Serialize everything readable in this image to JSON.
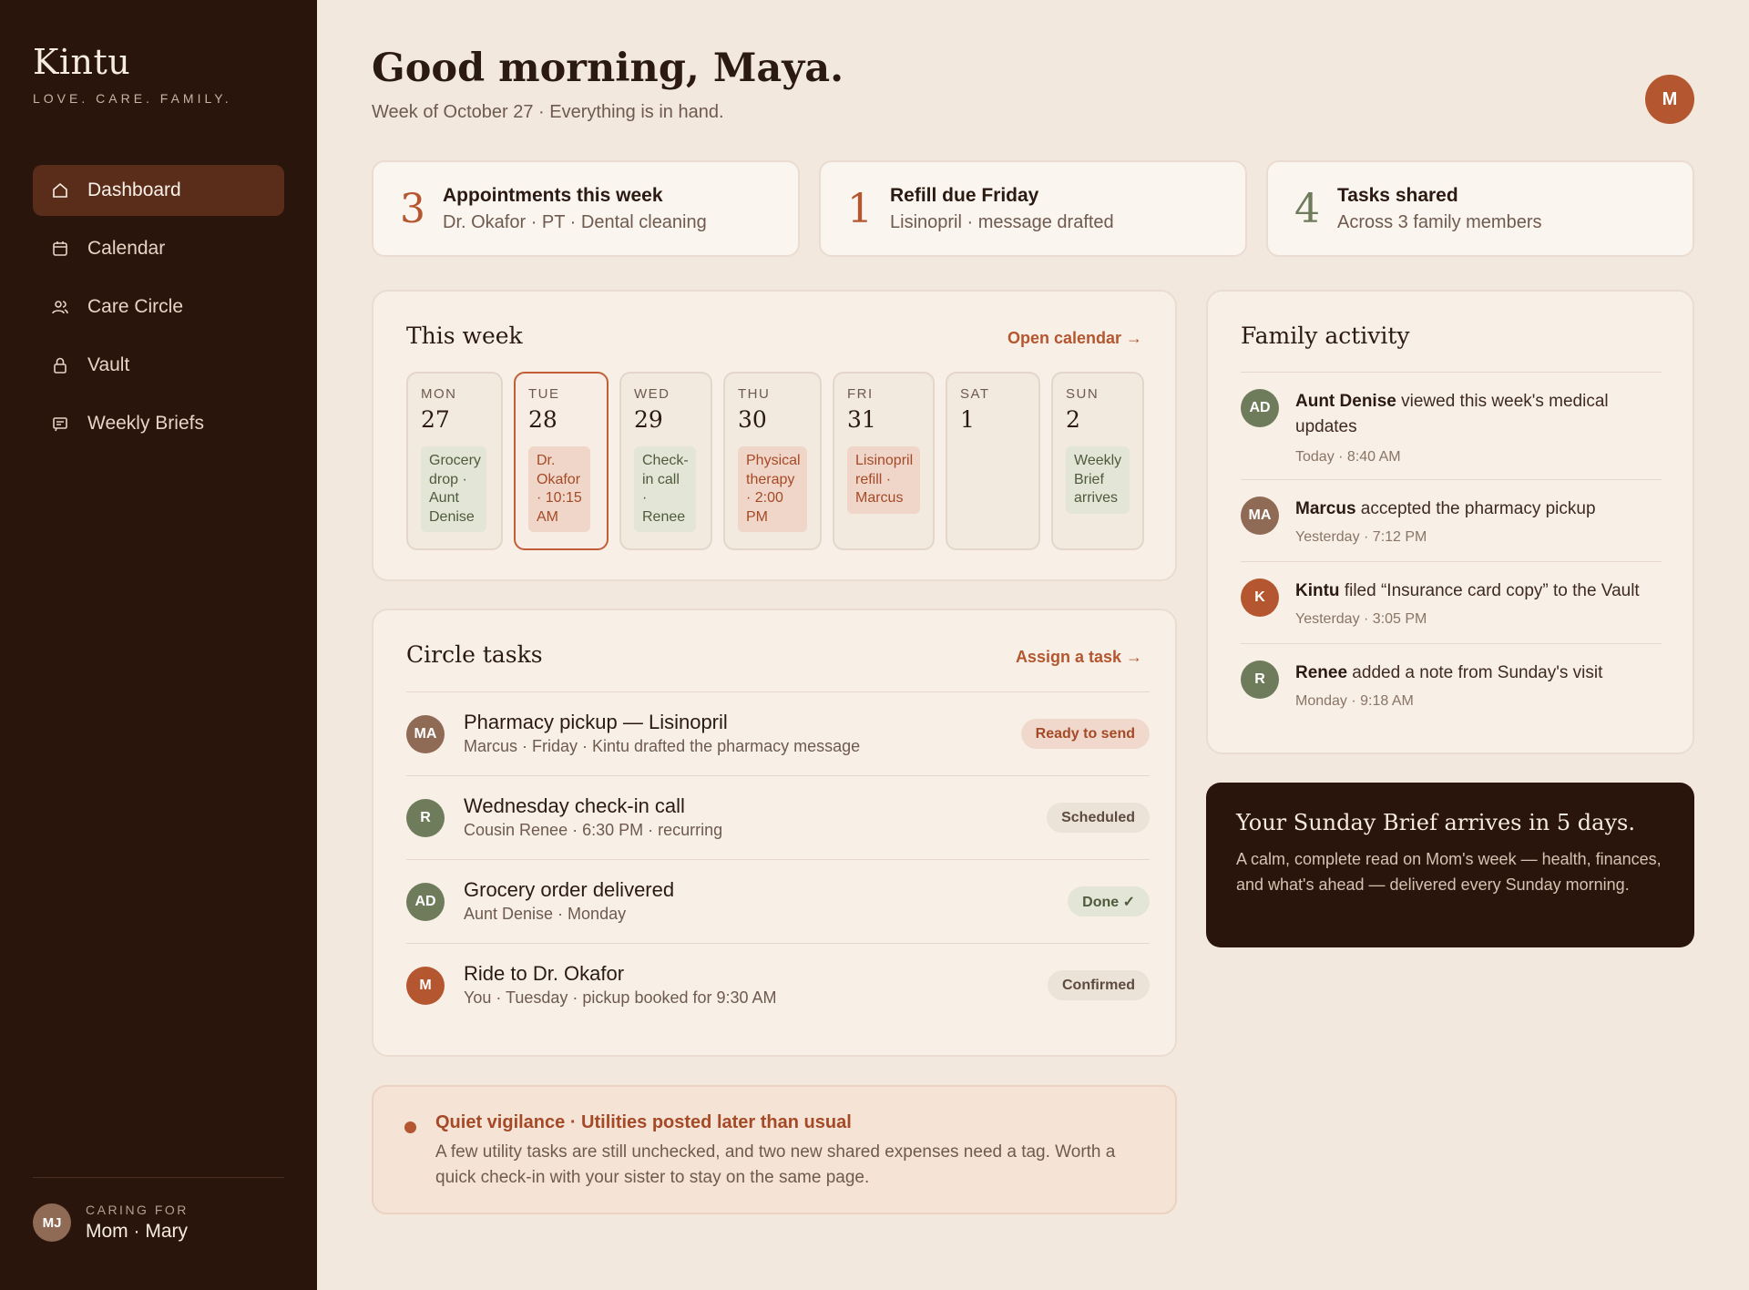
{
  "brand": {
    "name": "Kintu",
    "tagline": "LOVE. CARE. FAMILY."
  },
  "nav": [
    {
      "label": "Dashboard",
      "icon": "home-icon",
      "active": true
    },
    {
      "label": "Calendar",
      "icon": "calendar-icon"
    },
    {
      "label": "Care Circle",
      "icon": "people-icon"
    },
    {
      "label": "Vault",
      "icon": "lock-icon"
    },
    {
      "label": "Weekly Briefs",
      "icon": "brief-icon"
    }
  ],
  "caring_for": {
    "initials": "MJ",
    "label": "CARING FOR",
    "name": "Mom · Mary"
  },
  "header": {
    "greeting": "Good morning, Maya.",
    "subtitle": "Week of October 27 · Everything is in hand.",
    "user_initial": "M"
  },
  "stats": [
    {
      "num": "3",
      "title": "Appointments this week",
      "sub": "Dr. Okafor · PT · Dental cleaning",
      "color": "#b4562f"
    },
    {
      "num": "1",
      "title": "Refill due Friday",
      "sub": "Lisinopril · message drafted",
      "color": "#b4562f"
    },
    {
      "num": "4",
      "title": "Tasks shared",
      "sub": "Across 3 family members",
      "color": "#6f7c5c"
    }
  ],
  "week": {
    "title": "This week",
    "link": "Open calendar →",
    "days": [
      {
        "name": "MON",
        "num": "27",
        "event": "Grocery drop · Aunt Denise",
        "tone": "green"
      },
      {
        "name": "TUE",
        "num": "28",
        "event": "Dr. Okafor · 10:15 AM",
        "tone": "red",
        "today": true
      },
      {
        "name": "WED",
        "num": "29",
        "event": "Check-in call · Renee",
        "tone": "green"
      },
      {
        "name": "THU",
        "num": "30",
        "event": "Physical therapy · 2:00 PM",
        "tone": "red"
      },
      {
        "name": "FRI",
        "num": "31",
        "event": "Lisinopril refill · Marcus",
        "tone": "red"
      },
      {
        "name": "SAT",
        "num": "1",
        "event": ""
      },
      {
        "name": "SUN",
        "num": "2",
        "event": "Weekly Brief arrives",
        "tone": "green"
      }
    ]
  },
  "tasks": {
    "title": "Circle tasks",
    "link": "Assign a task →",
    "items": [
      {
        "initials": "MA",
        "title": "Pharmacy pickup — Lisinopril",
        "sub": "Marcus · Friday · Kintu drafted the pharmacy message",
        "status": "Ready to send"
      },
      {
        "initials": "R",
        "title": "Wednesday check-in call",
        "sub": "Cousin Renee · 6:30 PM · recurring",
        "status": "Scheduled"
      },
      {
        "initials": "AD",
        "title": "Grocery order delivered",
        "sub": "Aunt Denise · Monday",
        "status": "Done ✓"
      },
      {
        "initials": "M",
        "title": "Ride to Dr. Okafor",
        "sub": "You · Tuesday · pickup booked for 9:30 AM",
        "status": "Confirmed"
      }
    ]
  },
  "alert": {
    "title": "Quiet vigilance · Utilities posted later than usual",
    "body": "A few utility tasks are still unchecked, and two new shared expenses need a tag. Worth a quick check-in with your sister to stay on the same page."
  },
  "activity": {
    "title": "Family activity",
    "items": [
      {
        "initials": "AD",
        "who": "Aunt Denise",
        "what": " viewed this week's medical updates",
        "time": "Today · 8:40 AM"
      },
      {
        "initials": "MA",
        "who": "Marcus",
        "what": " accepted the pharmacy pickup",
        "time": "Yesterday · 7:12 PM"
      },
      {
        "initials": "K",
        "who": "Kintu",
        "what": " filed “Insurance card copy” to the Vault",
        "time": "Yesterday · 3:05 PM"
      },
      {
        "initials": "R",
        "who": "Renee",
        "what": " added a note from Sunday's visit",
        "time": "Monday · 9:18 AM"
      }
    ]
  },
  "brief": {
    "title": "Your Sunday Brief arrives in 5 days.",
    "body": "A calm, complete read on Mom's week — health, finances, and what's ahead — delivered every Sunday morning."
  }
}
